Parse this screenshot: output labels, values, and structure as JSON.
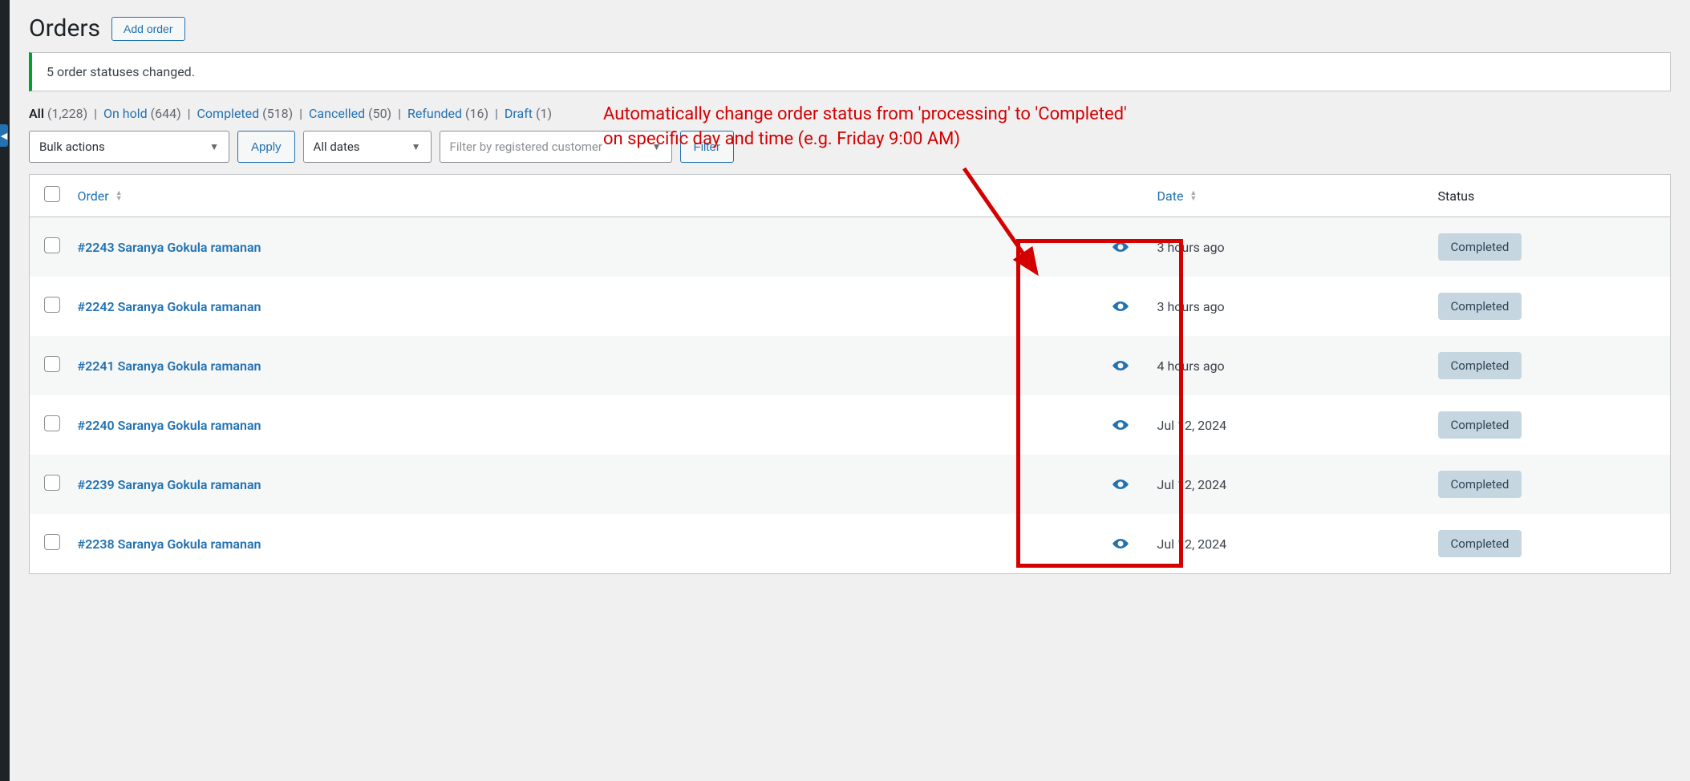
{
  "page": {
    "title": "Orders",
    "add_button": "Add order"
  },
  "notice": "5 order statuses changed.",
  "filters": {
    "all_label": "All",
    "all_count": "(1,228)",
    "onhold_label": "On hold",
    "onhold_count": "(644)",
    "completed_label": "Completed",
    "completed_count": "(518)",
    "cancelled_label": "Cancelled",
    "cancelled_count": "(50)",
    "refunded_label": "Refunded",
    "refunded_count": "(16)",
    "draft_label": "Draft",
    "draft_count": "(1)"
  },
  "controls": {
    "bulk_actions": "Bulk actions",
    "apply": "Apply",
    "all_dates": "All dates",
    "customer_placeholder": "Filter by registered customer",
    "filter": "Filter"
  },
  "columns": {
    "order": "Order",
    "date": "Date",
    "status": "Status"
  },
  "orders": [
    {
      "title": "#2243 Saranya Gokula ramanan",
      "date": "3 hours ago",
      "status": "Completed"
    },
    {
      "title": "#2242 Saranya Gokula ramanan",
      "date": "3 hours ago",
      "status": "Completed"
    },
    {
      "title": "#2241 Saranya Gokula ramanan",
      "date": "4 hours ago",
      "status": "Completed"
    },
    {
      "title": "#2240 Saranya Gokula ramanan",
      "date": "Jul 12, 2024",
      "status": "Completed"
    },
    {
      "title": "#2239 Saranya Gokula ramanan",
      "date": "Jul 12, 2024",
      "status": "Completed"
    },
    {
      "title": "#2238 Saranya Gokula ramanan",
      "date": "Jul 12, 2024",
      "status": "Completed"
    }
  ],
  "annotation": {
    "line1": "Automatically change order status from 'processing' to 'Completed'",
    "line2": "on specific day and time (e.g. Friday 9:00 AM)"
  }
}
